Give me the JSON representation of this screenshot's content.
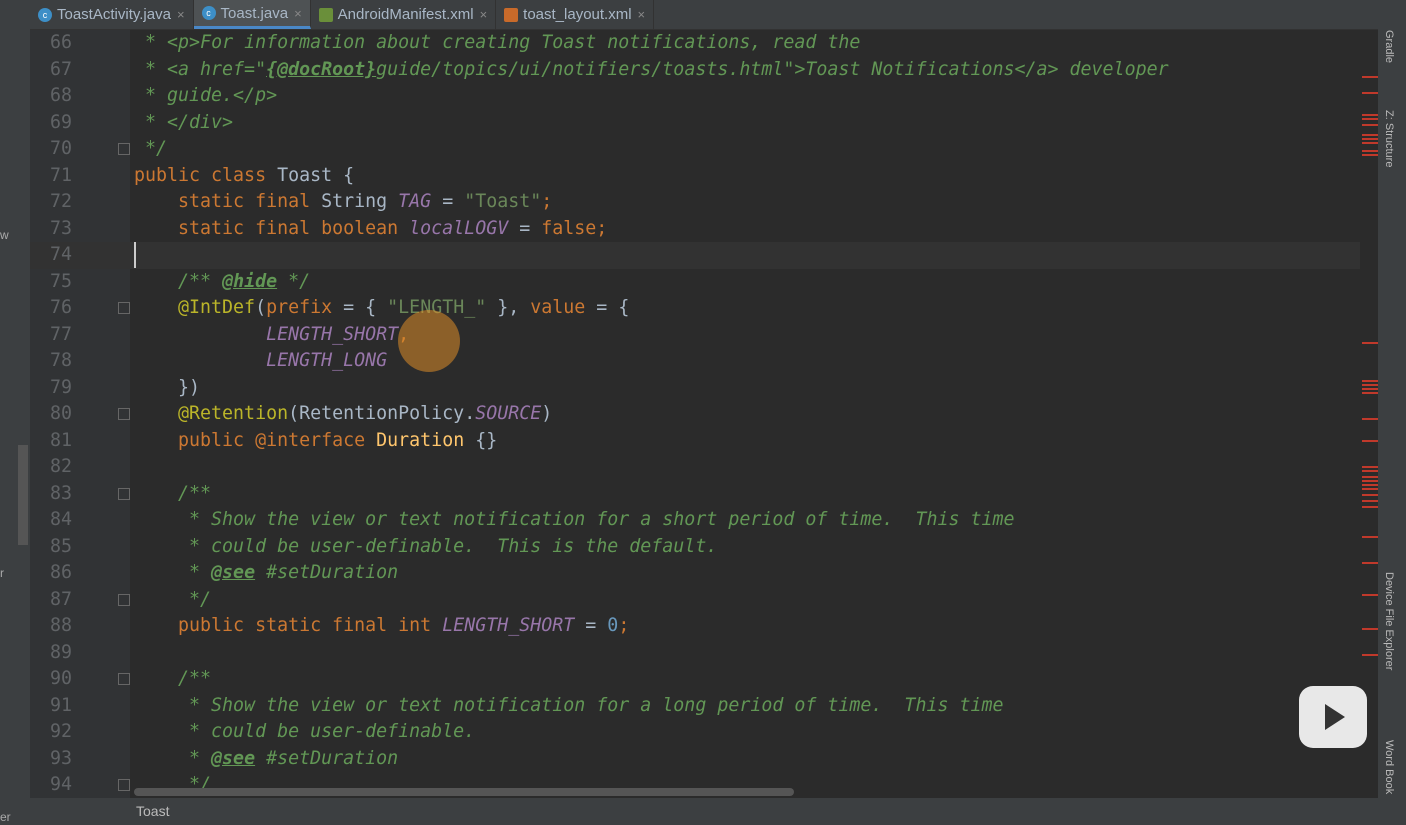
{
  "tabs": [
    {
      "label": "ToastActivity.java",
      "icon": "c-class-icon"
    },
    {
      "label": "Toast.java",
      "icon": "c-class-icon",
      "active": true
    },
    {
      "label": "AndroidManifest.xml",
      "icon": "manifest-icon"
    },
    {
      "label": "toast_layout.xml",
      "icon": "xml-layout-icon"
    }
  ],
  "left_strip": {
    "items": [
      "w",
      "r",
      "er"
    ]
  },
  "right_tools": [
    "Gradle",
    "Z: Structure",
    "Device File Explorer",
    "Word Book"
  ],
  "status": {
    "breadcrumb": "Toast"
  },
  "current_line": 74,
  "lines": [
    {
      "n": 66,
      "t": [
        [
          " * ",
          "c"
        ],
        [
          "<p>",
          "c"
        ],
        [
          "For information about creating Toast notifications, read the",
          "c"
        ]
      ]
    },
    {
      "n": 67,
      "t": [
        [
          " * <a href=\"",
          "c"
        ],
        [
          "{@docRoot}",
          "ct"
        ],
        [
          "guide/topics/ui/notifiers/toasts.html\">Toast Notifications</a> developer",
          "c"
        ]
      ]
    },
    {
      "n": 68,
      "t": [
        [
          " * guide.</p>",
          "c"
        ]
      ]
    },
    {
      "n": 69,
      "t": [
        [
          " * </div>",
          "c"
        ]
      ]
    },
    {
      "n": 70,
      "t": [
        [
          " */",
          "c"
        ]
      ],
      "fold": true
    },
    {
      "n": 71,
      "t": [
        [
          "public class ",
          "k"
        ],
        [
          "Toast {",
          ""
        ]
      ]
    },
    {
      "n": 72,
      "t": [
        [
          "    static final ",
          "k"
        ],
        [
          "String ",
          ""
        ],
        [
          "TAG",
          "i"
        ],
        [
          " = ",
          ""
        ],
        [
          "\"Toast\"",
          "s"
        ],
        [
          ";",
          "p"
        ]
      ]
    },
    {
      "n": 73,
      "t": [
        [
          "    static final boolean ",
          "k"
        ],
        [
          "localLOGV",
          "i"
        ],
        [
          " = ",
          ""
        ],
        [
          "false;",
          "k"
        ]
      ]
    },
    {
      "n": 74,
      "t": [
        [
          "",
          ""
        ]
      ]
    },
    {
      "n": 75,
      "t": [
        [
          "    /** ",
          "c"
        ],
        [
          "@hide",
          "ct"
        ],
        [
          " */",
          "c"
        ]
      ]
    },
    {
      "n": 76,
      "t": [
        [
          "    @IntDef",
          "a"
        ],
        [
          "(",
          ""
        ],
        [
          "prefix",
          "k"
        ],
        [
          " = { ",
          ""
        ],
        [
          "\"LENGTH_\"",
          "s"
        ],
        [
          " }, ",
          ""
        ],
        [
          "value",
          "k"
        ],
        [
          " = {",
          ""
        ]
      ],
      "fold": true
    },
    {
      "n": 77,
      "t": [
        [
          "            LENGTH_SHORT",
          "i"
        ],
        [
          ",",
          "p"
        ]
      ]
    },
    {
      "n": 78,
      "t": [
        [
          "            LENGTH_LONG",
          "i"
        ]
      ]
    },
    {
      "n": 79,
      "t": [
        [
          "    })",
          ""
        ]
      ]
    },
    {
      "n": 80,
      "t": [
        [
          "    @Retention",
          "a"
        ],
        [
          "(RetentionPolicy.",
          ""
        ],
        [
          "SOURCE",
          "i"
        ],
        [
          ")",
          ""
        ]
      ],
      "fold": true
    },
    {
      "n": 81,
      "t": [
        [
          "    public ",
          "k"
        ],
        [
          "@interface ",
          "k"
        ],
        [
          "Duration",
          "t"
        ],
        [
          " {}",
          ""
        ]
      ]
    },
    {
      "n": 82,
      "t": [
        [
          "",
          ""
        ]
      ]
    },
    {
      "n": 83,
      "t": [
        [
          "    /**",
          "c"
        ]
      ],
      "fold": true
    },
    {
      "n": 84,
      "t": [
        [
          "     * Show the view or text notification for a short period of time.  This time",
          "c"
        ]
      ]
    },
    {
      "n": 85,
      "t": [
        [
          "     * could be user-definable.  This is the default.",
          "c"
        ]
      ]
    },
    {
      "n": 86,
      "t": [
        [
          "     * ",
          "c"
        ],
        [
          "@see",
          "ct"
        ],
        [
          " #setDuration",
          "c"
        ]
      ]
    },
    {
      "n": 87,
      "t": [
        [
          "     */",
          "c"
        ]
      ],
      "fold": true
    },
    {
      "n": 88,
      "t": [
        [
          "    public static final int ",
          "k"
        ],
        [
          "LENGTH_SHORT",
          "i"
        ],
        [
          " = ",
          ""
        ],
        [
          "0",
          "n"
        ],
        [
          ";",
          "p"
        ]
      ]
    },
    {
      "n": 89,
      "t": [
        [
          "",
          ""
        ]
      ]
    },
    {
      "n": 90,
      "t": [
        [
          "    /**",
          "c"
        ]
      ],
      "fold": true
    },
    {
      "n": 91,
      "t": [
        [
          "     * Show the view or text notification for a long period of time.  This time",
          "c"
        ]
      ]
    },
    {
      "n": 92,
      "t": [
        [
          "     * could be user-definable.",
          "c"
        ]
      ]
    },
    {
      "n": 93,
      "t": [
        [
          "     * ",
          "c"
        ],
        [
          "@see",
          "ct"
        ],
        [
          " #setDuration",
          "c"
        ]
      ]
    },
    {
      "n": 94,
      "t": [
        [
          "     */",
          "c"
        ]
      ],
      "fold": true
    }
  ]
}
